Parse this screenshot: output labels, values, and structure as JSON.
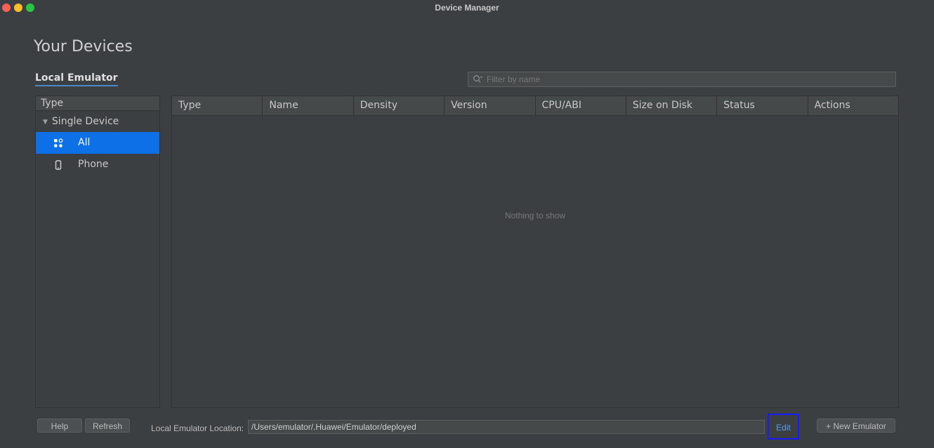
{
  "window": {
    "title": "Device Manager"
  },
  "page": {
    "heading": "Your Devices",
    "tab": "Local Emulator"
  },
  "filter": {
    "placeholder": "Filter by name"
  },
  "sidebar": {
    "header": "Type",
    "group": "Single Device",
    "items": [
      {
        "label": "All",
        "icon": "apps-grid-icon",
        "selected": true
      },
      {
        "label": "Phone",
        "icon": "phone-icon",
        "selected": false
      }
    ]
  },
  "table": {
    "columns": [
      "Type",
      "Name",
      "Density",
      "Version",
      "CPU/ABI",
      "Size on Disk",
      "Status",
      "Actions"
    ],
    "empty_text": "Nothing to show"
  },
  "footer": {
    "help_label": "Help",
    "refresh_label": "Refresh",
    "location_label": "Local Emulator Location:",
    "location_value": "/Users/emulator/.Huawei/Emulator/deployed",
    "edit_label": "Edit",
    "new_emulator_label": "+ New Emulator"
  },
  "colors": {
    "background": "#3c3f41",
    "selection": "#0d70e6",
    "link": "#589df6",
    "highlight_box": "#1a1aff"
  }
}
